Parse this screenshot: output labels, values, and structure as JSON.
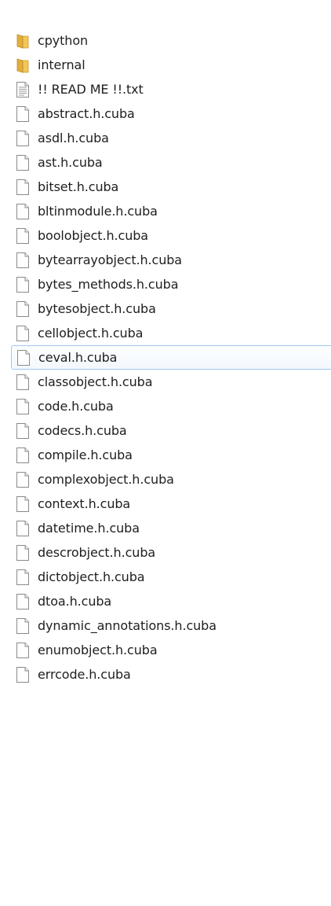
{
  "files": [
    {
      "name": "cpython",
      "icon": "folder-icon"
    },
    {
      "name": "internal",
      "icon": "folder-icon"
    },
    {
      "name": "!! READ ME !!.txt",
      "icon": "text-file-icon"
    },
    {
      "name": "abstract.h.cuba",
      "icon": "blank-file-icon"
    },
    {
      "name": "asdl.h.cuba",
      "icon": "blank-file-icon"
    },
    {
      "name": "ast.h.cuba",
      "icon": "blank-file-icon"
    },
    {
      "name": "bitset.h.cuba",
      "icon": "blank-file-icon"
    },
    {
      "name": "bltinmodule.h.cuba",
      "icon": "blank-file-icon"
    },
    {
      "name": "boolobject.h.cuba",
      "icon": "blank-file-icon"
    },
    {
      "name": "bytearrayobject.h.cuba",
      "icon": "blank-file-icon"
    },
    {
      "name": "bytes_methods.h.cuba",
      "icon": "blank-file-icon"
    },
    {
      "name": "bytesobject.h.cuba",
      "icon": "blank-file-icon"
    },
    {
      "name": "cellobject.h.cuba",
      "icon": "blank-file-icon"
    },
    {
      "name": "ceval.h.cuba",
      "icon": "blank-file-icon",
      "selected": true
    },
    {
      "name": "classobject.h.cuba",
      "icon": "blank-file-icon"
    },
    {
      "name": "code.h.cuba",
      "icon": "blank-file-icon"
    },
    {
      "name": "codecs.h.cuba",
      "icon": "blank-file-icon"
    },
    {
      "name": "compile.h.cuba",
      "icon": "blank-file-icon"
    },
    {
      "name": "complexobject.h.cuba",
      "icon": "blank-file-icon"
    },
    {
      "name": "context.h.cuba",
      "icon": "blank-file-icon"
    },
    {
      "name": "datetime.h.cuba",
      "icon": "blank-file-icon"
    },
    {
      "name": "descrobject.h.cuba",
      "icon": "blank-file-icon"
    },
    {
      "name": "dictobject.h.cuba",
      "icon": "blank-file-icon"
    },
    {
      "name": "dtoa.h.cuba",
      "icon": "blank-file-icon"
    },
    {
      "name": "dynamic_annotations.h.cuba",
      "icon": "blank-file-icon"
    },
    {
      "name": "enumobject.h.cuba",
      "icon": "blank-file-icon"
    },
    {
      "name": "errcode.h.cuba",
      "icon": "blank-file-icon"
    }
  ],
  "colors": {
    "folder": "#e8b64a",
    "file_border": "#8a8a8a",
    "selection_border": "#9fc8ee"
  }
}
